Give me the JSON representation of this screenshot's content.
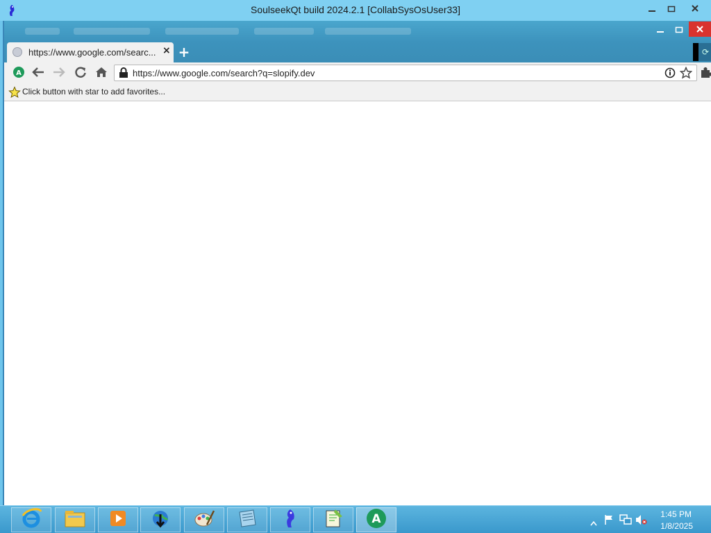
{
  "outer_window": {
    "title": "SoulseekQt build 2024.2.1 [CollabSysOsUser33]",
    "icons": {
      "app": "soulseek-bird-icon",
      "minimize": "minimize-icon",
      "maximize": "maximize-icon",
      "close": "close-icon"
    }
  },
  "browser": {
    "window_icons": {
      "minimize": "minimize-icon",
      "maximize": "maximize-icon",
      "close": "close-icon"
    },
    "tab": {
      "title": "https://www.google.com/searc...",
      "close_label": "×",
      "favicon": "globe-icon"
    },
    "new_tab_label": "+",
    "toolbar": {
      "profile_icon": "profile-a-icon",
      "back_icon": "back-arrow-icon",
      "forward_icon": "forward-arrow-icon",
      "reload_icon": "reload-icon",
      "home_icon": "home-icon",
      "lock_icon": "lock-icon",
      "url": "https://www.google.com/search?q=slopify.dev",
      "info_icon": "info-icon",
      "star_icon": "star-icon",
      "extensions_icon": "puzzle-icon"
    },
    "bookmarks_bar": {
      "star_icon": "favorite-star-icon",
      "hint": "Click button with star to add favorites..."
    }
  },
  "taskbar": {
    "apps": [
      {
        "name": "internet-explorer",
        "icon": "ie-icon"
      },
      {
        "name": "file-explorer",
        "icon": "folder-icon"
      },
      {
        "name": "media-player",
        "icon": "media-player-icon"
      },
      {
        "name": "download-manager",
        "icon": "download-globe-icon"
      },
      {
        "name": "paint",
        "icon": "paint-palette-icon"
      },
      {
        "name": "notepad",
        "icon": "notepad-icon"
      },
      {
        "name": "soulseek",
        "icon": "soulseek-bird-icon"
      },
      {
        "name": "notepad-plus",
        "icon": "notepad-plus-icon"
      },
      {
        "name": "browser-a",
        "icon": "browser-a-icon"
      }
    ],
    "tray": {
      "time": "1:45 PM",
      "date": "1/8/2025",
      "icons": [
        "show-hidden-icons-chevron-icon",
        "action-center-flag-icon",
        "network-icon",
        "volume-muted-icon"
      ]
    }
  },
  "colors": {
    "taskbar": "#3a98cc",
    "outer_frame": "#7fd0f2",
    "browser_frame": "#3d93bd",
    "toolbar": "#f1f1f1"
  }
}
